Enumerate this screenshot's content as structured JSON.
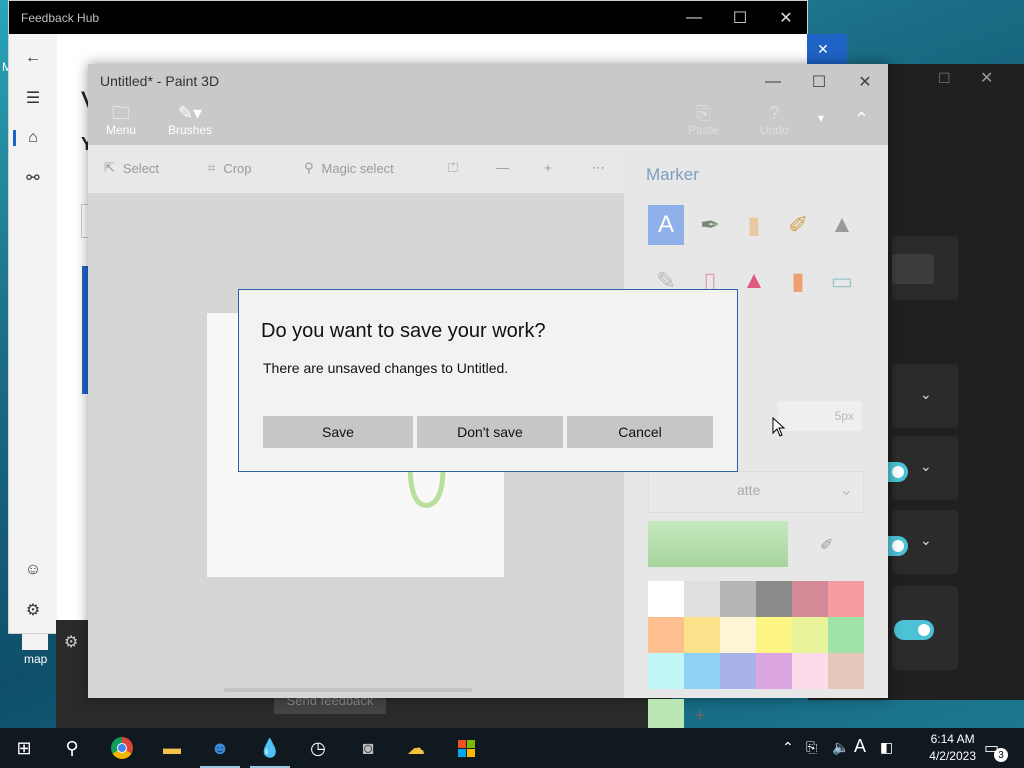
{
  "desktop": {
    "icon_label": "map",
    "left_letter": "M"
  },
  "feedback_hub": {
    "title": "Feedback Hub",
    "heading_letter_1": "V",
    "heading_letter_2": "Y",
    "send_feedback_label": "Send feedback"
  },
  "paint3d": {
    "title": "Untitled* - Paint 3D",
    "ribbon": {
      "menu_label": "Menu",
      "brushes_label": "Brushes",
      "paste_label": "Paste",
      "undo_label": "Undo"
    },
    "tools": {
      "select_label": "Select",
      "crop_label": "Crop",
      "magic_select_label": "Magic select"
    },
    "panel": {
      "title": "Marker",
      "thickness_value": "5px",
      "matte_label": "atte"
    },
    "palette_colors": [
      "#ffffff",
      "#e0e0e0",
      "#b5b5b5",
      "#8a8a8a",
      "#d18a96",
      "#f59ca1",
      "#fdbf8f",
      "#fde28c",
      "#fef4d6",
      "#fdf684",
      "#e8f39a",
      "#9fe3a8",
      "#c3f6f6",
      "#8fd0f5",
      "#a9b1ea",
      "#dba5e1",
      "#fddbea",
      "#e4c7b9"
    ],
    "selected_color": "#b9e6b3"
  },
  "dialog": {
    "title": "Do you want to save your work?",
    "message": "There are unsaved changes to Untitled.",
    "save_label": "Save",
    "dont_save_label": "Don't save",
    "cancel_label": "Cancel"
  },
  "taskbar": {
    "time": "6:14 AM",
    "date": "4/2/2023",
    "notification_count": "3",
    "language_indicator": "A"
  }
}
